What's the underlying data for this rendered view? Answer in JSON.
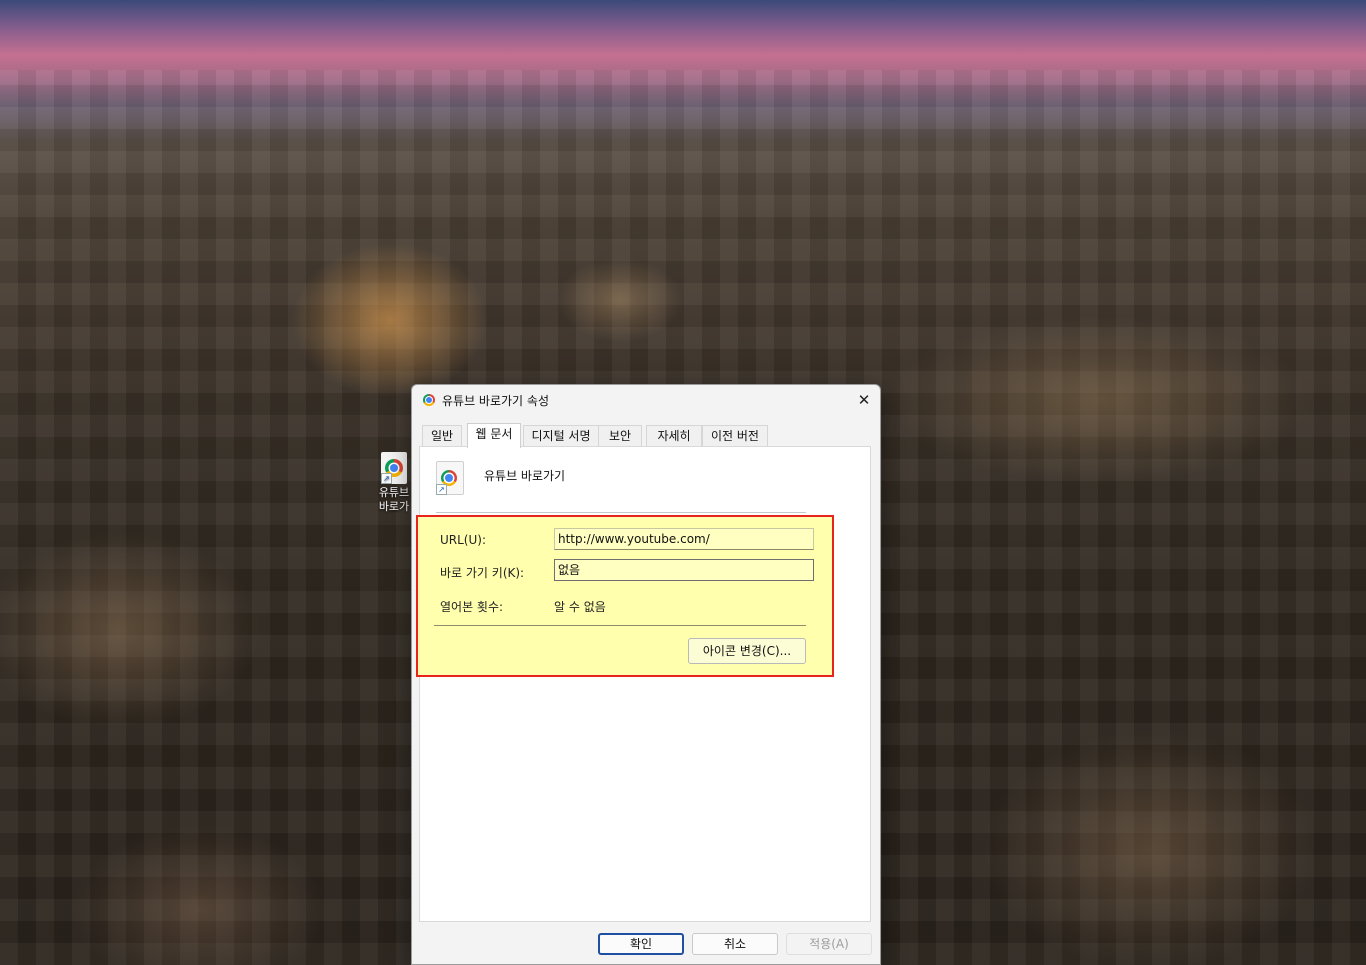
{
  "desktop": {
    "icon_label_line1": "유튜브",
    "icon_label_line2": "바로가"
  },
  "dialog": {
    "title": "유튜브 바로가기 속성",
    "close_glyph": "✕",
    "tabs": [
      {
        "label": "일반"
      },
      {
        "label": "웹 문서",
        "active": true
      },
      {
        "label": "디지털 서명"
      },
      {
        "label": "보안"
      },
      {
        "label": "자세히"
      },
      {
        "label": "이전 버전"
      }
    ],
    "shortcut_name": "유튜브 바로가기",
    "fields": {
      "url_label": "URL(U):",
      "url_value": "http://www.youtube.com/",
      "hotkey_label": "바로 가기 키(K):",
      "hotkey_value": "없음",
      "visits_label": "열어본 횟수:",
      "visits_value": "알 수 없음"
    },
    "change_icon_label": "아이콘 변경(C)...",
    "buttons": {
      "ok": "확인",
      "cancel": "취소",
      "apply": "적용(A)"
    },
    "highlight_color": "#e8231c",
    "highlight_fill": "#ffff96"
  },
  "icons": {
    "shortcut_icon": "chrome-shortcut-icon",
    "close_icon": "close-icon"
  }
}
